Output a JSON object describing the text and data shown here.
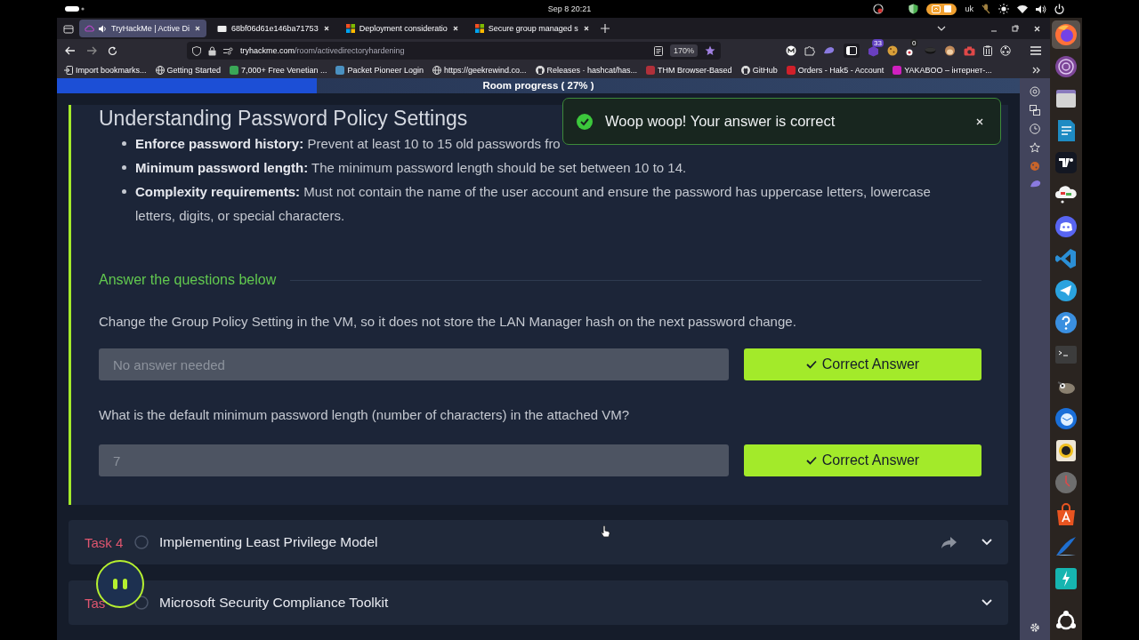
{
  "top_bar": {
    "date_time": "Sep 8  20:21",
    "keyboard_layout": "uk"
  },
  "tabs": [
    {
      "kind": "thm",
      "label": "TryHackMe | Active Di",
      "selected": true,
      "playing_audio": true
    },
    {
      "kind": "page",
      "label": "68bf06d61e146ba71753",
      "selected": false,
      "playing_audio": false
    },
    {
      "kind": "microsoft",
      "label": "Deployment consideratio",
      "selected": false,
      "playing_audio": false
    },
    {
      "kind": "microsoft",
      "label": "Secure group managed s",
      "selected": false,
      "playing_audio": false
    }
  ],
  "address_bar": {
    "host": "tryhackme.com",
    "path": "/room/activedirectoryhardening",
    "zoom": "170%"
  },
  "toolbar": {
    "badges": [
      "33",
      "0"
    ]
  },
  "bookmarks": [
    {
      "kind": "import",
      "label": "Import bookmarks..."
    },
    {
      "kind": "globe",
      "label": "Getting Started"
    },
    {
      "kind": "dot",
      "color": "#3aa757",
      "label": "7,000+ Free Venetian ..."
    },
    {
      "kind": "dot",
      "color": "#4a90c0",
      "label": "Packet Pioneer Login"
    },
    {
      "kind": "globe",
      "label": "https://geekrewind.co..."
    },
    {
      "kind": "github",
      "label": "Releases · hashcat/has..."
    },
    {
      "kind": "dot",
      "color": "#b0303a",
      "label": "THM Browser-Based"
    },
    {
      "kind": "github",
      "label": "GitHub"
    },
    {
      "kind": "dot",
      "color": "#d0202a",
      "label": "Orders - Hak5 - Account"
    },
    {
      "kind": "dot",
      "color": "#d020c0",
      "label": "YAKABOO – інтернет-..."
    }
  ],
  "progress": {
    "label": "Room progress ( 27% )",
    "level": 0.27
  },
  "section": {
    "heading": "Understanding Password Policy Settings",
    "bullets": [
      "**Enforce password history:** Prevent at least 10 to 15 old passwords fro",
      "**Minimum password length:** The minimum password length should be set between 10 to 14.",
      "**Complexity requirements:** Must not contain the name of the user account and ensure the password has uppercase letters, lowercase letters, digits, or special characters."
    ],
    "questions_heading": "Answer the questions below",
    "questions": [
      {
        "text": "Change the Group Policy Setting in the VM, so it does not store the LAN Manager hash on the next password change.",
        "answer": "No answer needed",
        "disabled": true,
        "button": "Correct Answer"
      },
      {
        "text": "What is the default minimum password length (number of characters) in the attached VM?",
        "answer": "7",
        "disabled": true,
        "button": "Correct Answer"
      }
    ]
  },
  "toast": {
    "message": "Woop woop! Your answer is correct"
  },
  "tasks": [
    {
      "label": "Task 4",
      "title": "Implementing Least Privilege Model",
      "completed": false,
      "share": true
    },
    {
      "label": "Tas",
      "title": "Microsoft Security Compliance Toolkit",
      "completed": false,
      "share": false
    }
  ]
}
